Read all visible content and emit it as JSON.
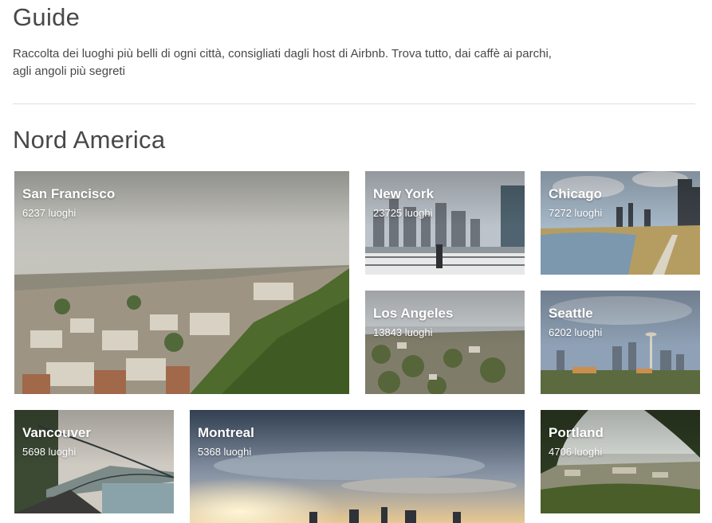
{
  "page": {
    "title": "Guide",
    "intro": "Raccolta dei luoghi più belli di ogni città, consigliati dagli host di Airbnb. Trova tutto, dai caffè ai parchi, agli angoli più segreti"
  },
  "section": {
    "title": "Nord America",
    "cities": [
      {
        "name": "San Francisco",
        "count": "6237 luoghi"
      },
      {
        "name": "New York",
        "count": "23725 luoghi"
      },
      {
        "name": "Chicago",
        "count": "7272 luoghi"
      },
      {
        "name": "Los Angeles",
        "count": "13843 luoghi"
      },
      {
        "name": "Seattle",
        "count": "6202 luoghi"
      },
      {
        "name": "Vancouver",
        "count": "5698 luoghi"
      },
      {
        "name": "Montreal",
        "count": "5368 luoghi"
      },
      {
        "name": "Portland",
        "count": "4706 luoghi"
      }
    ]
  },
  "colors": {
    "text": "#484848",
    "divider": "#dce0e0",
    "overlay_text": "#ffffff"
  }
}
